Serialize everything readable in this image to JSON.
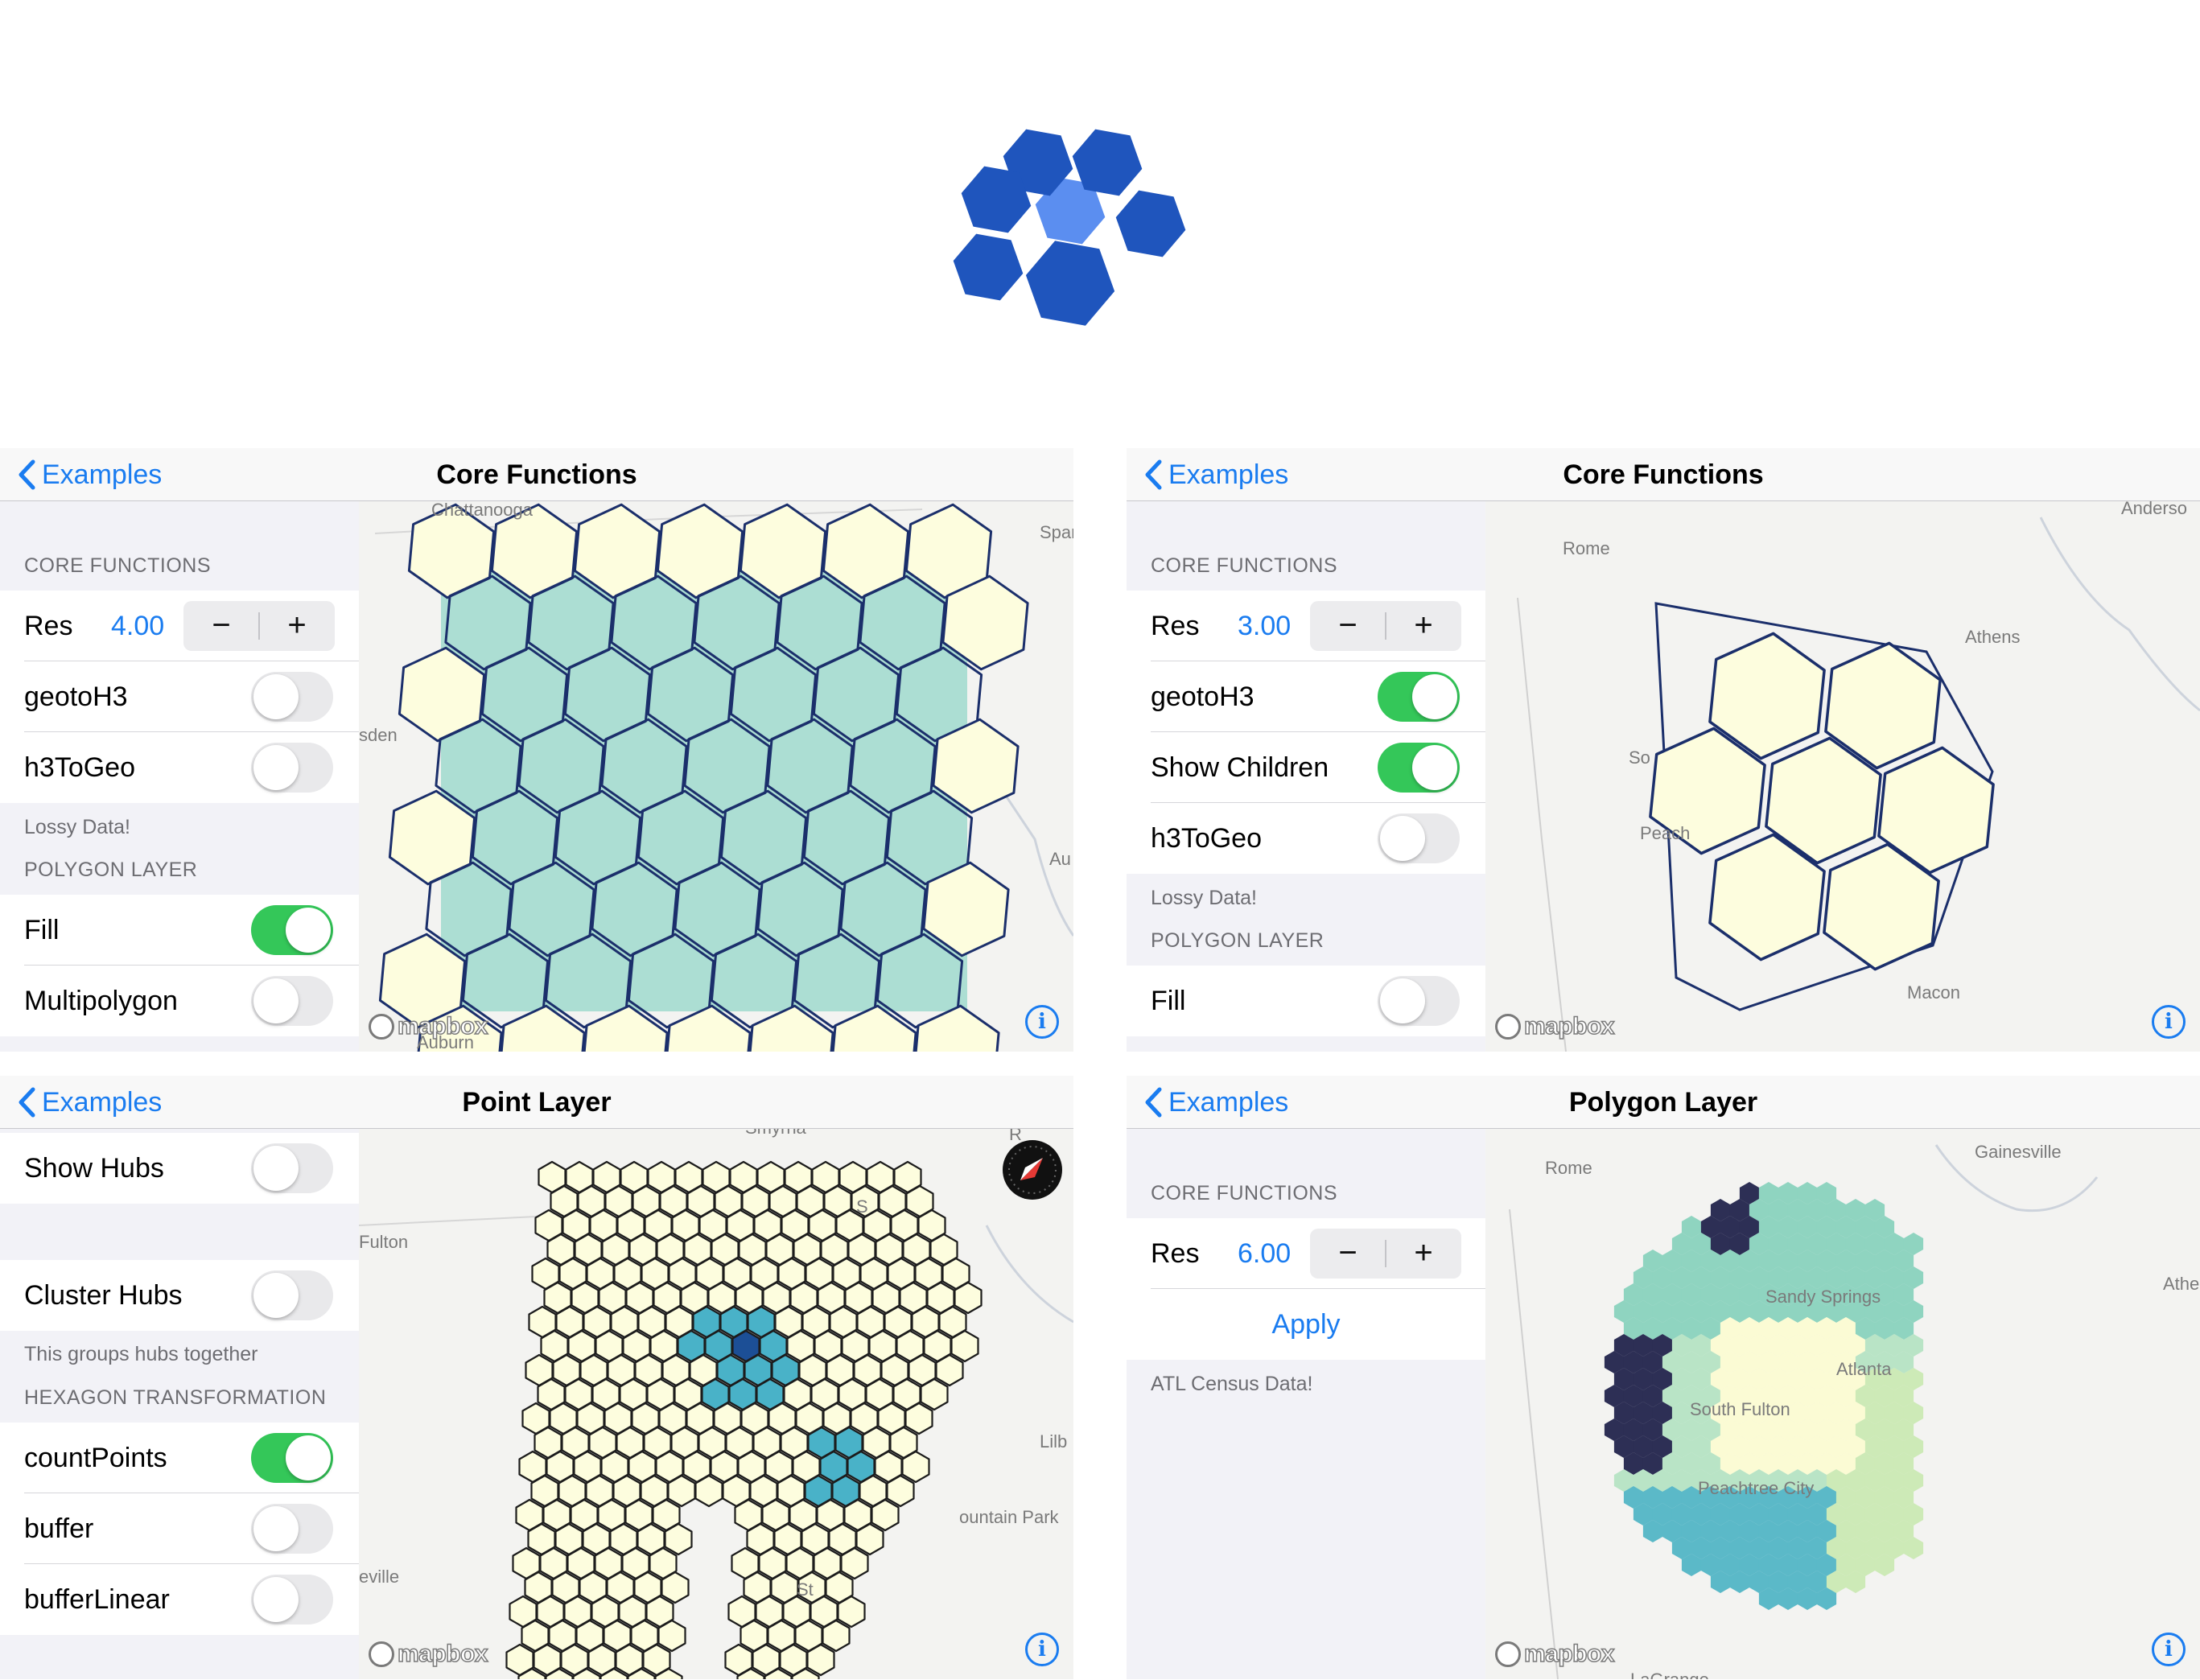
{
  "logo": {
    "icon": "h3-hexagon-logo-icon",
    "colors": {
      "dark": "#1f55bd",
      "light": "#5b8ef0"
    }
  },
  "colors": {
    "accent": "#1a7cf0",
    "toggle_on": "#34c759",
    "hex_fill": "#fdfdde",
    "hex_stroke": "#1b2f6b",
    "polygon_fill": "#9cd9cc"
  },
  "panels": [
    {
      "back": "Examples",
      "title": "Core Functions",
      "sections": {
        "core": "CORE FUNCTIONS",
        "polygon": "POLYGON LAYER"
      },
      "res_label": "Res",
      "res_value": "4.00",
      "toggles": [
        {
          "label": "geotoH3",
          "on": false
        },
        {
          "label": "h3ToGeo",
          "on": false
        },
        {
          "label": "Fill",
          "on": true
        },
        {
          "label": "Multipolygon",
          "on": false
        }
      ],
      "footer": "Lossy Data!",
      "places": [
        "Chattanooga",
        "Spar",
        "sden",
        "Au",
        "Auburn"
      ],
      "mapbox": "mapbox",
      "info": "i"
    },
    {
      "back": "Examples",
      "title": "Core Functions",
      "sections": {
        "core": "CORE FUNCTIONS",
        "polygon": "POLYGON LAYER"
      },
      "res_label": "Res",
      "res_value": "3.00",
      "toggles": [
        {
          "label": "geotoH3",
          "on": true
        },
        {
          "label": "Show Children",
          "on": true
        },
        {
          "label": "h3ToGeo",
          "on": false
        },
        {
          "label": "Fill",
          "on": false
        }
      ],
      "footer": "Lossy Data!",
      "places": [
        "Anderso",
        "Rome",
        "Athens",
        "So",
        "Peach",
        "Macon"
      ],
      "mapbox": "mapbox",
      "info": "i"
    },
    {
      "back": "Examples",
      "title": "Point Layer",
      "sections": {
        "hex": "HEXAGON TRANSFORMATION"
      },
      "toggles": [
        {
          "label": "Show Hubs",
          "on": false
        },
        {
          "label": "Cluster Hubs",
          "on": false
        },
        {
          "label": "countPoints",
          "on": true
        },
        {
          "label": "buffer",
          "on": false
        },
        {
          "label": "bufferLinear",
          "on": false
        }
      ],
      "footer": "This groups hubs together",
      "places": [
        "Smyrna",
        "Fulton",
        "Lilb",
        "ountain Park",
        "eville",
        "St",
        "R",
        "S"
      ],
      "mapbox": "mapbox",
      "info": "i"
    },
    {
      "back": "Examples",
      "title": "Polygon Layer",
      "sections": {
        "core": "CORE FUNCTIONS"
      },
      "res_label": "Res",
      "res_value": "6.00",
      "apply": "Apply",
      "footer": "ATL Census Data!",
      "places": [
        "Rome",
        "Gainesville",
        "Athen",
        "Sandy Springs",
        "Atlanta",
        "South Fulton",
        "Peachtree City",
        "LaGrange"
      ],
      "mapbox": "mapbox",
      "info": "i"
    }
  ]
}
